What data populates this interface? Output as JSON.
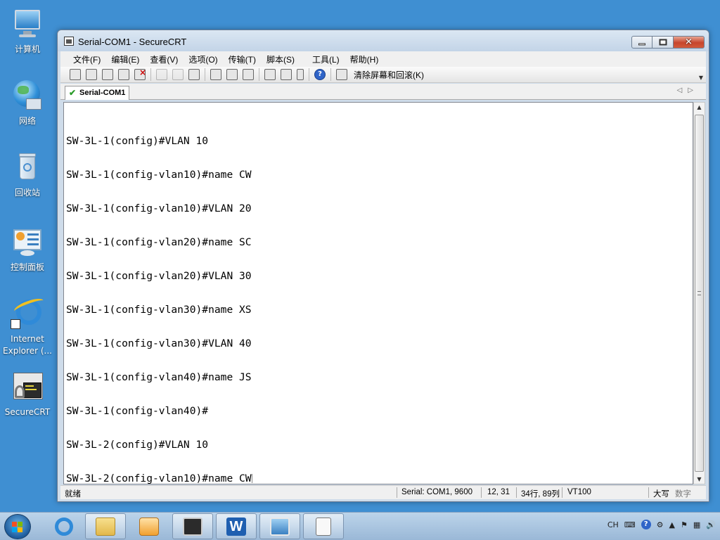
{
  "desktop": {
    "icons": [
      {
        "label": "计算机"
      },
      {
        "label": "网络"
      },
      {
        "label": "回收站"
      },
      {
        "label": "控制面板"
      },
      {
        "label": "Internet Explorer (...",
        "label_line1": "Internet",
        "label_line2": "Explorer (..."
      },
      {
        "label": "SecureCRT"
      }
    ]
  },
  "window": {
    "title": "Serial-COM1 - SecureCRT",
    "menu": [
      "文件(F)",
      "编辑(E)",
      "查看(V)",
      "选项(O)",
      "传输(T)",
      "脚本(S)",
      "工具(L)",
      "帮助(H)"
    ],
    "toolbar": {
      "clear_label": "清除屏幕和回滚(K)"
    },
    "tab": {
      "label": "Serial-COM1"
    },
    "terminal": {
      "lines": [
        "SW-3L-1(config)#VLAN 10",
        "SW-3L-1(config-vlan10)#name CW",
        "SW-3L-1(config-vlan10)#VLAN 20",
        "SW-3L-1(config-vlan20)#name SC",
        "SW-3L-1(config-vlan20)#VLAN 30",
        "SW-3L-1(config-vlan30)#name XS",
        "SW-3L-1(config-vlan30)#VLAN 40",
        "SW-3L-1(config-vlan40)#name JS",
        "SW-3L-1(config-vlan40)#",
        "SW-3L-2(config)#VLAN 10",
        "SW-3L-2(config-vlan10)#name CW"
      ]
    },
    "status": {
      "ready": "就绪",
      "serial": "Serial: COM1, 9600",
      "cursor": "12, 31",
      "size": "34行, 89列",
      "emulation": "VT100",
      "caps": "大写",
      "num": "数字"
    }
  },
  "taskbar": {
    "tray": {
      "lang": "CH"
    }
  },
  "colors": {
    "desktop": "#3f8fd2",
    "window_frame": "#cfdcea",
    "close_button": "#c7452c"
  }
}
